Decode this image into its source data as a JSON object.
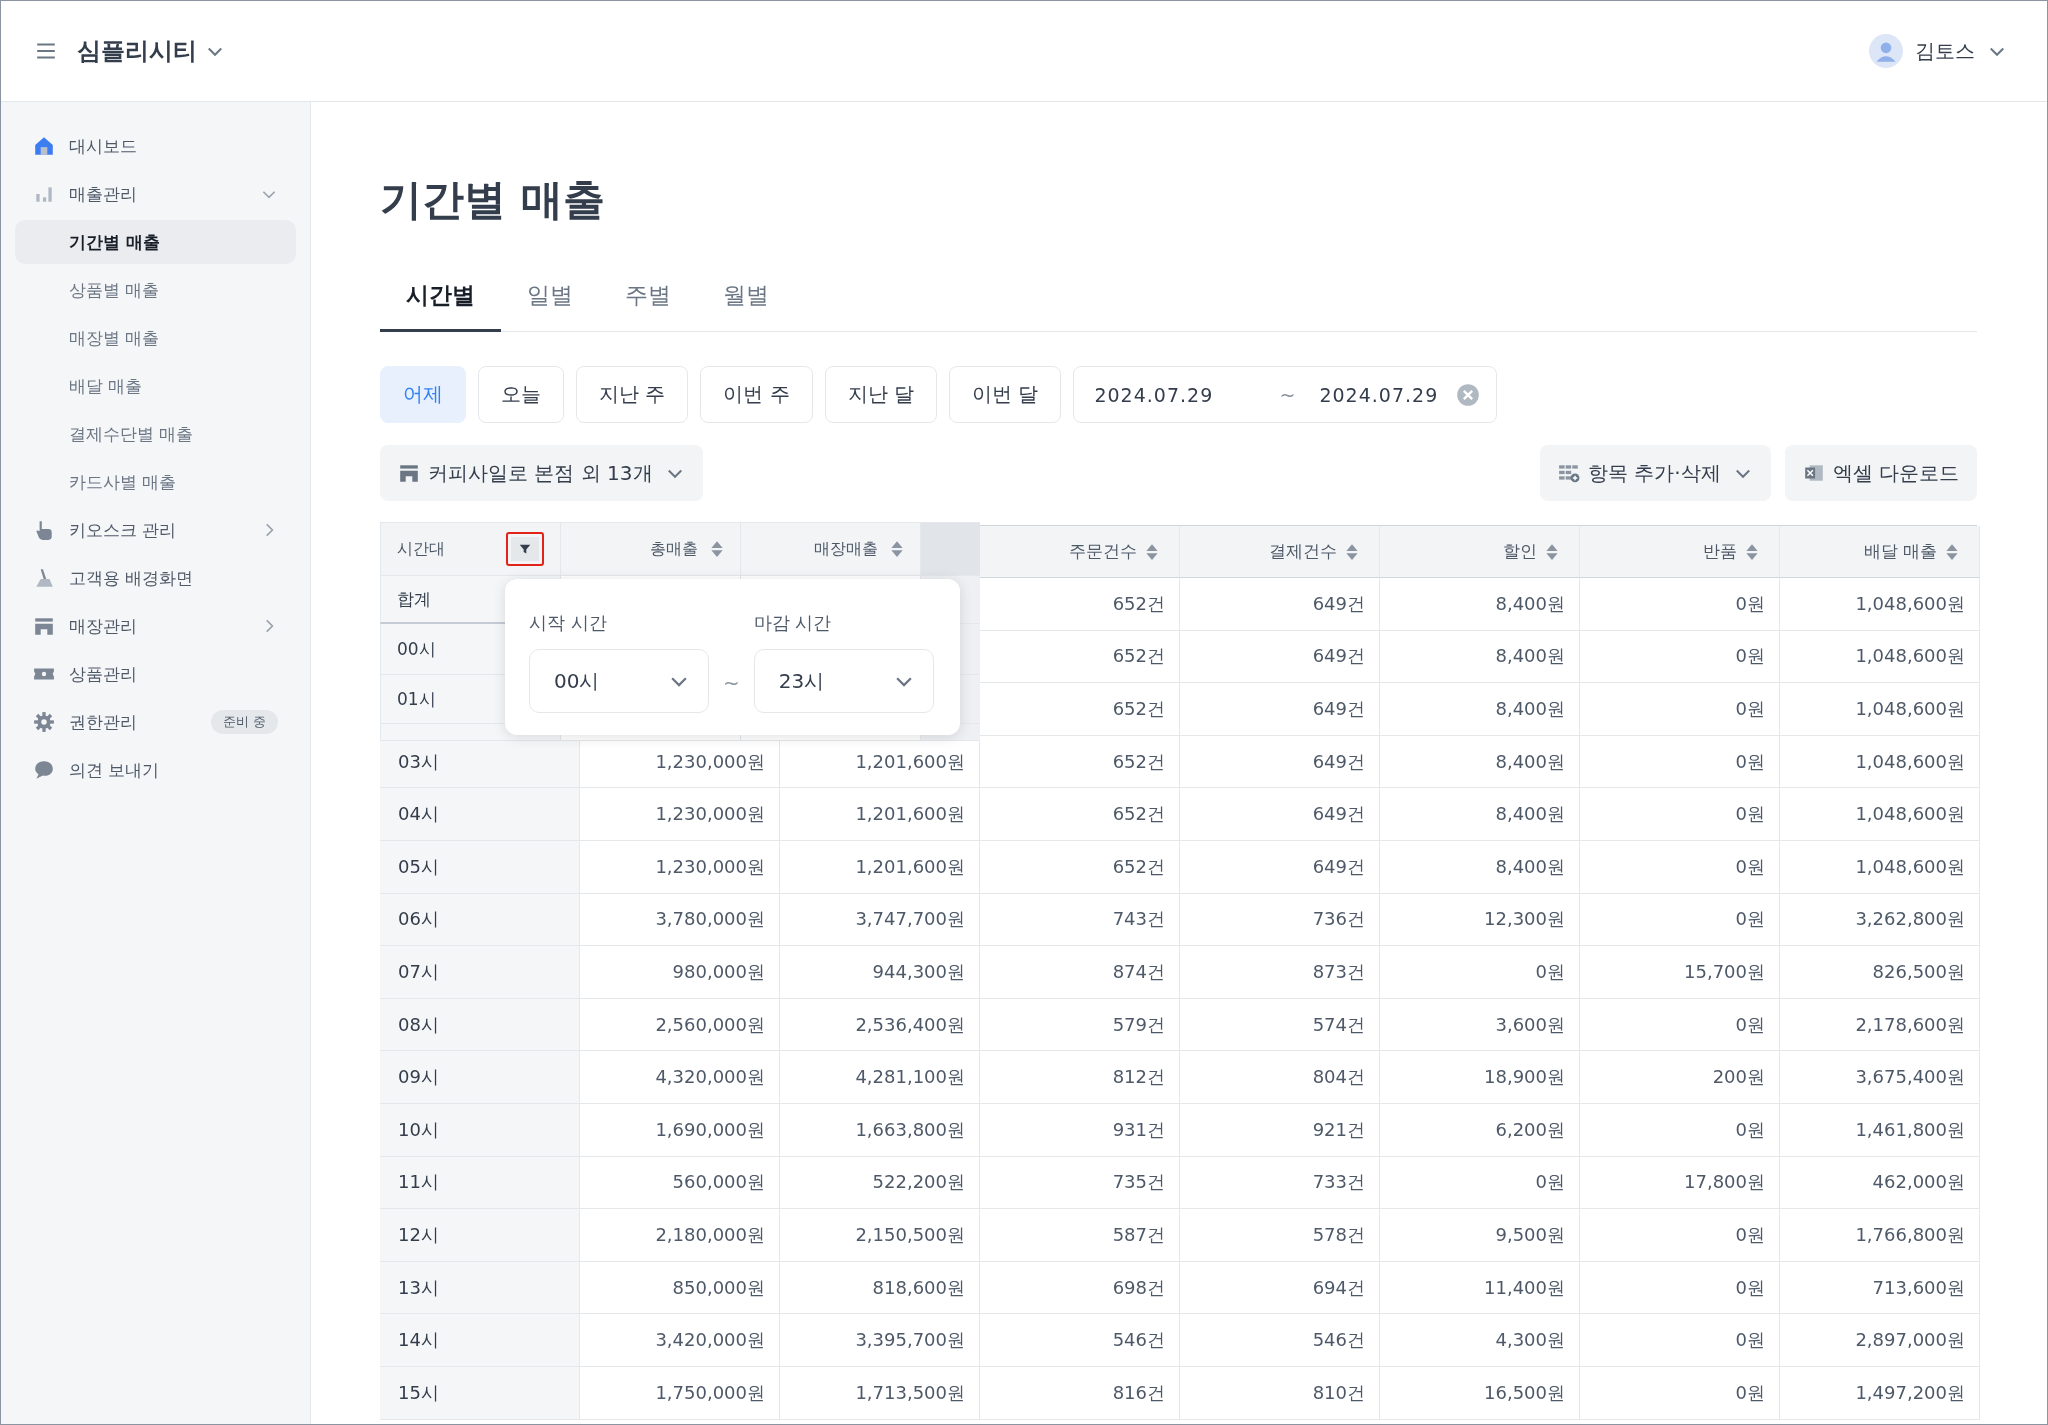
{
  "header": {
    "brand": "심플리시티",
    "user": "김토스"
  },
  "sidebar": {
    "items": [
      {
        "label": "대시보드",
        "selected": false
      },
      {
        "label": "매출관리",
        "selected": false,
        "expanded": true,
        "children": [
          {
            "label": "기간별 매출",
            "selected": true
          },
          {
            "label": "상품별 매출",
            "selected": false
          },
          {
            "label": "매장별 매출",
            "selected": false
          },
          {
            "label": "배달 매출",
            "selected": false
          },
          {
            "label": "결제수단별 매출",
            "selected": false
          },
          {
            "label": "카드사별 매출",
            "selected": false
          }
        ]
      },
      {
        "label": "키오스크 관리",
        "selected": false,
        "expanded": false
      },
      {
        "label": "고객용 배경화면",
        "selected": false
      },
      {
        "label": "매장관리",
        "selected": false,
        "expanded": false
      },
      {
        "label": "상품관리",
        "selected": false
      },
      {
        "label": "권한관리",
        "selected": false,
        "badge": "준비 중"
      },
      {
        "label": "의견 보내기",
        "selected": false
      }
    ]
  },
  "page_title": "기간별 매출",
  "tabs": [
    {
      "label": "시간별",
      "selected": true
    },
    {
      "label": "일별",
      "selected": false
    },
    {
      "label": "주별",
      "selected": false
    },
    {
      "label": "월별",
      "selected": false
    }
  ],
  "ranges": [
    {
      "label": "어제",
      "selected": true
    },
    {
      "label": "오늘",
      "selected": false
    },
    {
      "label": "지난 주",
      "selected": false
    },
    {
      "label": "이번 주",
      "selected": false
    },
    {
      "label": "지난 달",
      "selected": false
    },
    {
      "label": "이번 달",
      "selected": false
    }
  ],
  "date_range": {
    "start": "2024.07.29",
    "separator": "~",
    "end": "2024.07.29"
  },
  "store_filter": "커피사일로 본점 외 13개",
  "column_button": "항목 추가·삭제",
  "excel_button": "엑셀 다운로드",
  "table": {
    "columns": [
      {
        "label": "시간대",
        "kind": "filter"
      },
      {
        "label": "총매출",
        "kind": "sort"
      },
      {
        "label": "매장매출",
        "kind": "sort"
      },
      {
        "label": "주문건수",
        "kind": "sort"
      },
      {
        "label": "결제건수",
        "kind": "sort"
      },
      {
        "label": "할인",
        "kind": "sort"
      },
      {
        "label": "반품",
        "kind": "sort"
      },
      {
        "label": "배달 매출",
        "kind": "sort"
      }
    ],
    "rows": [
      {
        "cells": [
          "",
          "",
          "",
          "652건",
          "649건",
          "8,400원",
          "0원",
          "1,048,600원"
        ]
      },
      {
        "cells": [
          "",
          "",
          "",
          "652건",
          "649건",
          "8,400원",
          "0원",
          "1,048,600원"
        ]
      },
      {
        "cells": [
          "",
          "",
          "",
          "652건",
          "649건",
          "8,400원",
          "0원",
          "1,048,600원"
        ]
      },
      {
        "cells": [
          "03시",
          "1,230,000원",
          "1,201,600원",
          "652건",
          "649건",
          "8,400원",
          "0원",
          "1,048,600원"
        ]
      },
      {
        "cells": [
          "04시",
          "1,230,000원",
          "1,201,600원",
          "652건",
          "649건",
          "8,400원",
          "0원",
          "1,048,600원"
        ]
      },
      {
        "cells": [
          "05시",
          "1,230,000원",
          "1,201,600원",
          "652건",
          "649건",
          "8,400원",
          "0원",
          "1,048,600원"
        ]
      },
      {
        "cells": [
          "06시",
          "3,780,000원",
          "3,747,700원",
          "743건",
          "736건",
          "12,300원",
          "0원",
          "3,262,800원"
        ]
      },
      {
        "cells": [
          "07시",
          "980,000원",
          "944,300원",
          "874건",
          "873건",
          "0원",
          "15,700원",
          "826,500원"
        ]
      },
      {
        "cells": [
          "08시",
          "2,560,000원",
          "2,536,400원",
          "579건",
          "574건",
          "3,600원",
          "0원",
          "2,178,600원"
        ]
      },
      {
        "cells": [
          "09시",
          "4,320,000원",
          "4,281,100원",
          "812건",
          "804건",
          "18,900원",
          "200원",
          "3,675,400원"
        ]
      },
      {
        "cells": [
          "10시",
          "1,690,000원",
          "1,663,800원",
          "931건",
          "921건",
          "6,200원",
          "0원",
          "1,461,800원"
        ]
      },
      {
        "cells": [
          "11시",
          "560,000원",
          "522,200원",
          "735건",
          "733건",
          "0원",
          "17,800원",
          "462,000원"
        ]
      },
      {
        "cells": [
          "12시",
          "2,180,000원",
          "2,150,500원",
          "587건",
          "578건",
          "9,500원",
          "0원",
          "1,766,800원"
        ]
      },
      {
        "cells": [
          "13시",
          "850,000원",
          "818,600원",
          "698건",
          "694건",
          "11,400원",
          "0원",
          "713,600원"
        ]
      },
      {
        "cells": [
          "14시",
          "3,420,000원",
          "3,395,700원",
          "546건",
          "546건",
          "4,300원",
          "0원",
          "2,897,000원"
        ]
      },
      {
        "cells": [
          "15시",
          "1,750,000원",
          "1,713,500원",
          "816건",
          "810건",
          "16,500원",
          "0원",
          "1,497,200원"
        ]
      }
    ]
  },
  "inset": {
    "rows": [
      "합계",
      "00시",
      "01시"
    ],
    "popover": {
      "start_label": "시작 시간",
      "start_value": "00시",
      "separator": "~",
      "end_label": "마감 시간",
      "end_value": "23시"
    }
  }
}
